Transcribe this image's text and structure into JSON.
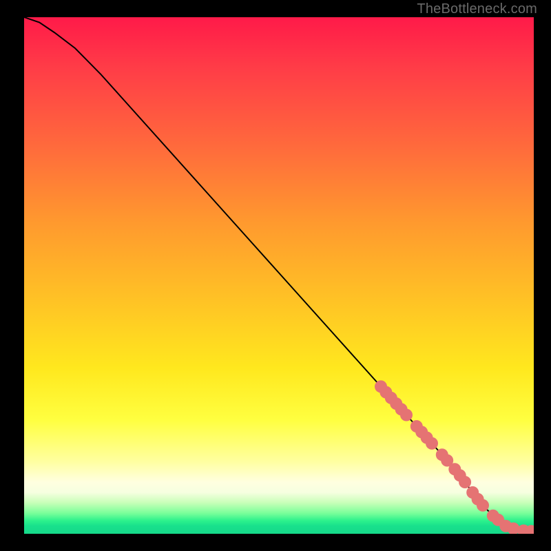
{
  "watermark": "TheBottleneck.com",
  "chart_data": {
    "type": "line",
    "title": "",
    "xlabel": "",
    "ylabel": "",
    "xlim": [
      0,
      100
    ],
    "ylim": [
      0,
      100
    ],
    "grid": false,
    "legend": false,
    "curve": {
      "name": "bottleneck-curve",
      "x": [
        0,
        3,
        6,
        10,
        15,
        20,
        25,
        30,
        35,
        40,
        45,
        50,
        55,
        60,
        65,
        70,
        75,
        80,
        85,
        88,
        90,
        92,
        94,
        96,
        98,
        100
      ],
      "y": [
        100,
        99,
        97,
        94,
        89,
        83.5,
        78,
        72.5,
        67,
        61.5,
        56,
        50.5,
        45,
        39.5,
        34,
        28.5,
        23,
        17.5,
        12,
        8,
        5.5,
        3.5,
        2,
        1,
        0.5,
        0.5
      ],
      "color": "#000000"
    },
    "markers": {
      "name": "highlighted-segment",
      "color": "#e57373",
      "radius_px": 9,
      "points": [
        {
          "x": 70.0,
          "y": 28.5
        },
        {
          "x": 71.0,
          "y": 27.4
        },
        {
          "x": 72.0,
          "y": 26.3
        },
        {
          "x": 73.0,
          "y": 25.2
        },
        {
          "x": 74.0,
          "y": 24.1
        },
        {
          "x": 75.0,
          "y": 23.0
        },
        {
          "x": 77.0,
          "y": 20.8
        },
        {
          "x": 78.0,
          "y": 19.7
        },
        {
          "x": 79.0,
          "y": 18.6
        },
        {
          "x": 80.0,
          "y": 17.5
        },
        {
          "x": 82.0,
          "y": 15.3
        },
        {
          "x": 83.0,
          "y": 14.2
        },
        {
          "x": 84.5,
          "y": 12.5
        },
        {
          "x": 85.5,
          "y": 11.3
        },
        {
          "x": 86.5,
          "y": 10.0
        },
        {
          "x": 88.0,
          "y": 8.0
        },
        {
          "x": 89.0,
          "y": 6.7
        },
        {
          "x": 90.0,
          "y": 5.5
        },
        {
          "x": 92.0,
          "y": 3.5
        },
        {
          "x": 93.0,
          "y": 2.7
        },
        {
          "x": 94.5,
          "y": 1.5
        },
        {
          "x": 96.0,
          "y": 1.0
        },
        {
          "x": 98.0,
          "y": 0.6
        },
        {
          "x": 99.5,
          "y": 0.5
        }
      ]
    }
  }
}
